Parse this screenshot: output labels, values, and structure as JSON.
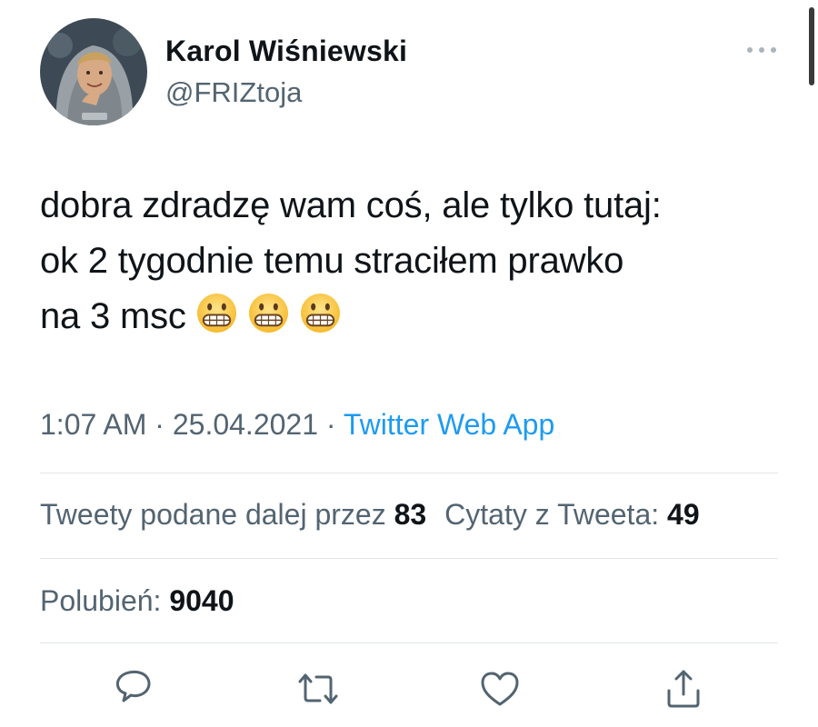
{
  "author": {
    "name": "Karol Wiśniewski",
    "handle": "@FRIZtoja"
  },
  "tweet": {
    "lines": [
      "dobra zdradzę wam coś, ale tylko tutaj:",
      "ok 2 tygodnie temu straciłem prawko",
      "na 3 msc"
    ],
    "emojis": [
      "grimacing-face",
      "grimacing-face",
      "grimacing-face"
    ]
  },
  "meta": {
    "time": "1:07 AM",
    "separator": "·",
    "date": "25.04.2021",
    "source": "Twitter Web App"
  },
  "stats": {
    "retweets_label": "Tweety podane dalej przez",
    "retweets_count": "83",
    "quotes_label": "Cytaty z Tweeta:",
    "quotes_count": "49",
    "likes_label": "Polubień:",
    "likes_count": "9040"
  },
  "actions": [
    "reply-icon",
    "retweet-icon",
    "like-icon",
    "share-icon"
  ],
  "colors": {
    "text": "#0f1419",
    "secondary": "#536471",
    "link": "#1d9bf0",
    "divider": "#e1e5e9"
  }
}
